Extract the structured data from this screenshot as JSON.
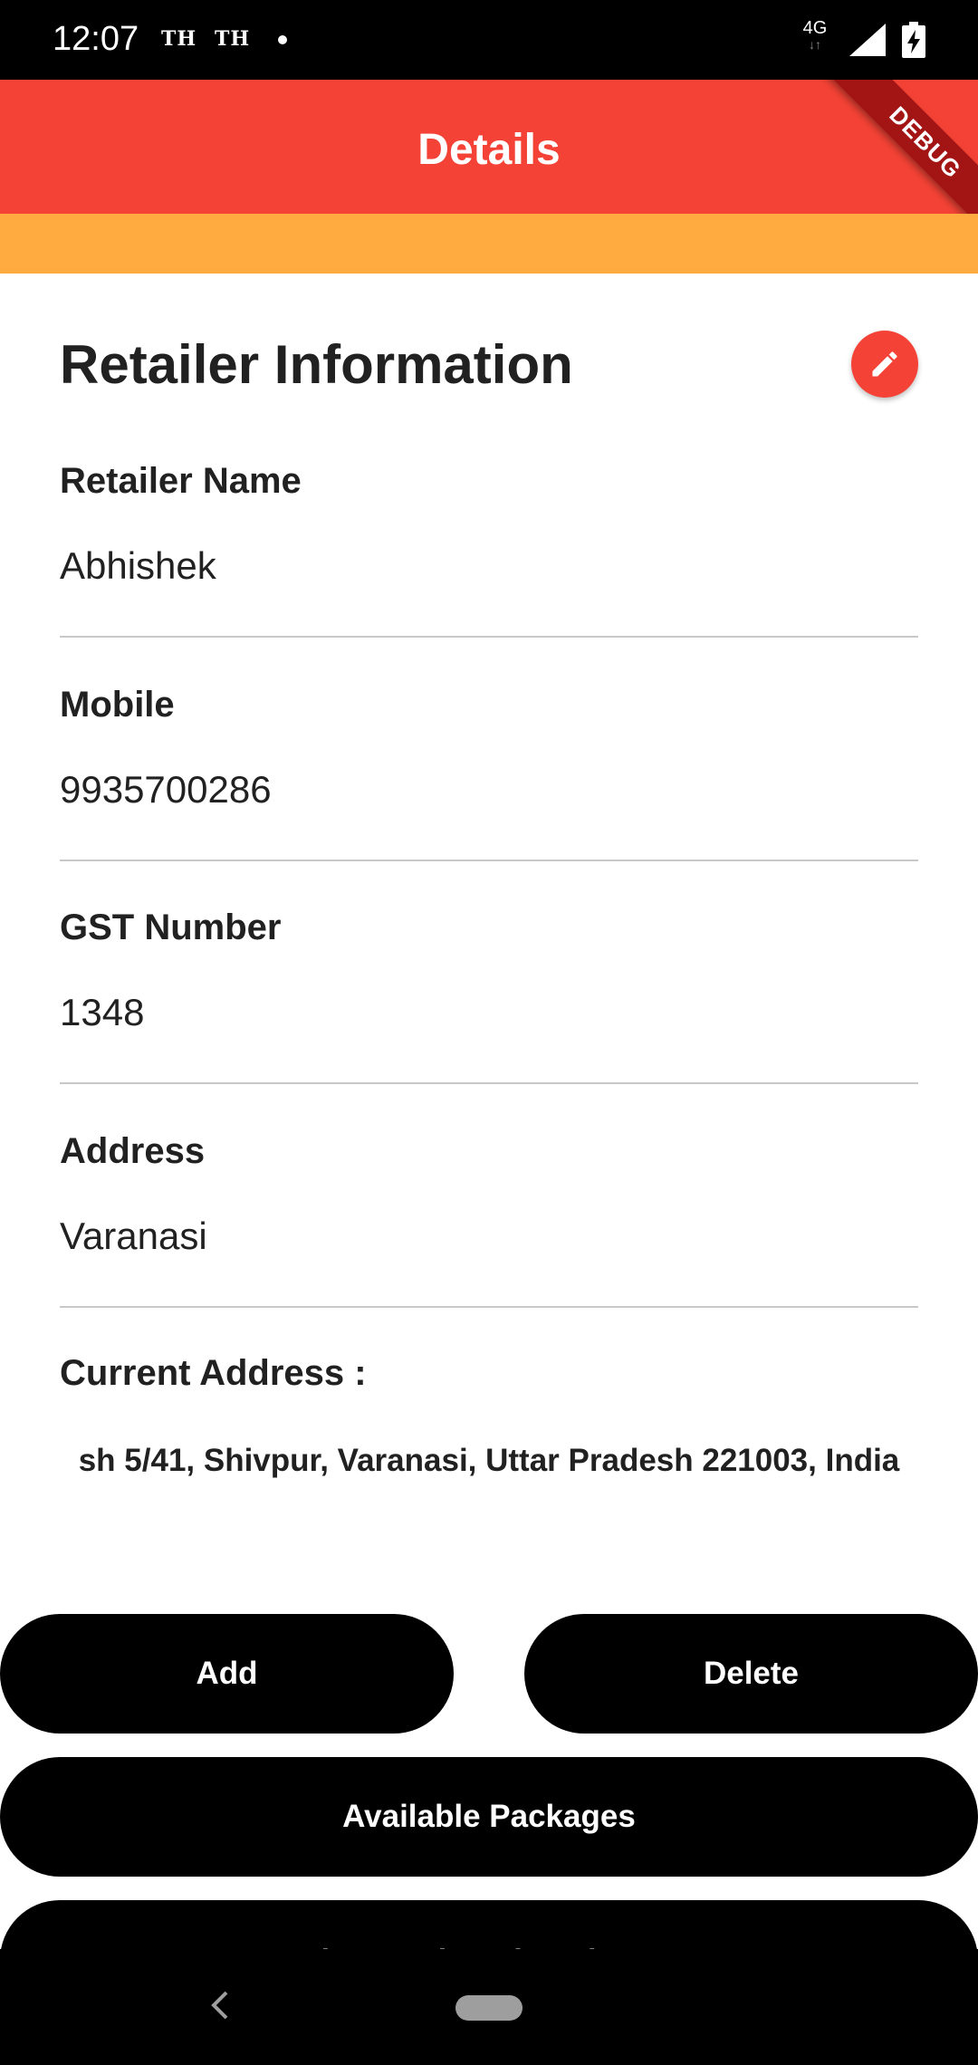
{
  "status_bar": {
    "time": "12:07",
    "carrier_1": "TH",
    "carrier_2": "TH",
    "network": "4G"
  },
  "app_bar": {
    "title": "Details",
    "debug_label": "DEBUG",
    "color": "#F44336"
  },
  "sub_bar": {
    "color": "#FFAB40"
  },
  "section": {
    "title": "Retailer Information",
    "edit_icon": "pencil-icon"
  },
  "fields": [
    {
      "label": "Retailer Name",
      "value": "Abhishek"
    },
    {
      "label": "Mobile",
      "value": "9935700286"
    },
    {
      "label": "GST Number",
      "value": "1348"
    },
    {
      "label": "Address",
      "value": "Varanasi"
    }
  ],
  "current_address": {
    "label": "Current Address :",
    "value": "sh 5/41, Shivpur, Varanasi, Uttar Pradesh 221003, India"
  },
  "buttons": {
    "add": "Add",
    "delete": "Delete",
    "available_packages": "Available Packages",
    "view_assigned": "View Assigned Packages"
  },
  "nav_bar": {
    "back_icon": "back-chevron-icon",
    "home_icon": "home-pill-icon"
  }
}
